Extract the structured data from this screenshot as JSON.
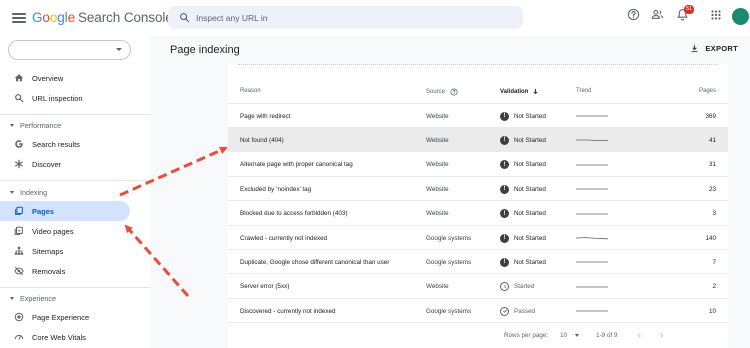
{
  "header": {
    "logo_google": [
      "G",
      "o",
      "o",
      "g",
      "l",
      "e"
    ],
    "logo_product": "Search Console",
    "search_placeholder": "Inspect any URL in",
    "notification_count": "51"
  },
  "sidebar": {
    "items_top": [
      {
        "label": "Overview",
        "icon": "home-icon"
      },
      {
        "label": "URL inspection",
        "icon": "search-icon"
      }
    ],
    "sections": [
      {
        "title": "Performance",
        "items": [
          {
            "label": "Search results",
            "icon": "google-g-icon"
          },
          {
            "label": "Discover",
            "icon": "asterisk-icon"
          }
        ]
      },
      {
        "title": "Indexing",
        "items": [
          {
            "label": "Pages",
            "icon": "pages-icon",
            "active": true
          },
          {
            "label": "Video pages",
            "icon": "video-pages-icon"
          },
          {
            "label": "Sitemaps",
            "icon": "sitemap-icon"
          },
          {
            "label": "Removals",
            "icon": "removals-icon"
          }
        ]
      },
      {
        "title": "Experience",
        "items": [
          {
            "label": "Page Experience",
            "icon": "page-experience-icon"
          },
          {
            "label": "Core Web Vitals",
            "icon": "gauge-icon"
          }
        ]
      }
    ]
  },
  "main": {
    "title": "Page indexing",
    "export_label": "EXPORT",
    "table": {
      "headers": {
        "reason": "Reason",
        "source": "Source",
        "validation": "Validation",
        "trend": "Trend",
        "pages": "Pages"
      },
      "rows": [
        {
          "reason": "Page with redirect",
          "source": "Website",
          "validation": "Not Started",
          "status": "not-started",
          "pages": "369"
        },
        {
          "reason": "Not found (404)",
          "source": "Website",
          "validation": "Not Started",
          "status": "not-started",
          "pages": "41",
          "highlighted": true
        },
        {
          "reason": "Alternate page with proper canonical tag",
          "source": "Website",
          "validation": "Not Started",
          "status": "not-started",
          "pages": "31"
        },
        {
          "reason": "Excluded by ‘noindex’ tag",
          "source": "Website",
          "validation": "Not Started",
          "status": "not-started",
          "pages": "23"
        },
        {
          "reason": "Blocked due to access forbidden (403)",
          "source": "Website",
          "validation": "Not Started",
          "status": "not-started",
          "pages": "3"
        },
        {
          "reason": "Crawled - currently not indexed",
          "source": "Google systems",
          "validation": "Not Started",
          "status": "not-started",
          "pages": "140"
        },
        {
          "reason": "Duplicate, Google chose different canonical than user",
          "source": "Google systems",
          "validation": "Not Started",
          "status": "not-started",
          "pages": "7"
        },
        {
          "reason": "Server error (5xx)",
          "source": "Website",
          "validation": "Started",
          "status": "started",
          "pages": "2"
        },
        {
          "reason": "Discovered - currently not indexed",
          "source": "Google systems",
          "validation": "Passed",
          "status": "passed",
          "pages": "10"
        }
      ]
    },
    "pagination": {
      "rows_per_page_label": "Rows per page:",
      "rows_per_page": "10",
      "range": "1-9 of 9"
    }
  },
  "colors": {
    "accent": "#0b57d0",
    "active_bg": "#d3e3fd",
    "arrow": "#e84d3d",
    "avatar": "#1b8a73",
    "badge": "#d93025"
  }
}
